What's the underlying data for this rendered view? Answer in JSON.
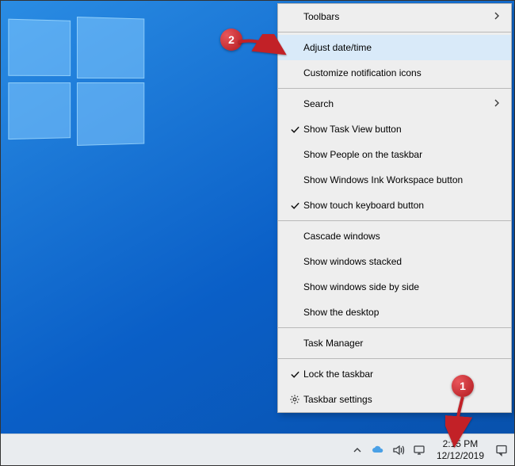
{
  "menu": {
    "items": [
      {
        "label": "Toolbars",
        "checked": false,
        "submenu": true,
        "icon": null
      },
      {
        "label": "Adjust date/time",
        "checked": false,
        "submenu": false,
        "icon": null
      },
      {
        "label": "Customize notification icons",
        "checked": false,
        "submenu": false,
        "icon": null
      },
      {
        "label": "Search",
        "checked": false,
        "submenu": true,
        "icon": null
      },
      {
        "label": "Show Task View button",
        "checked": true,
        "submenu": false,
        "icon": null
      },
      {
        "label": "Show People on the taskbar",
        "checked": false,
        "submenu": false,
        "icon": null
      },
      {
        "label": "Show Windows Ink Workspace button",
        "checked": false,
        "submenu": false,
        "icon": null
      },
      {
        "label": "Show touch keyboard button",
        "checked": true,
        "submenu": false,
        "icon": null
      },
      {
        "label": "Cascade windows",
        "checked": false,
        "submenu": false,
        "icon": null
      },
      {
        "label": "Show windows stacked",
        "checked": false,
        "submenu": false,
        "icon": null
      },
      {
        "label": "Show windows side by side",
        "checked": false,
        "submenu": false,
        "icon": null
      },
      {
        "label": "Show the desktop",
        "checked": false,
        "submenu": false,
        "icon": null
      },
      {
        "label": "Task Manager",
        "checked": false,
        "submenu": false,
        "icon": null
      },
      {
        "label": "Lock the taskbar",
        "checked": true,
        "submenu": false,
        "icon": null
      },
      {
        "label": "Taskbar settings",
        "checked": false,
        "submenu": false,
        "icon": "gear"
      }
    ],
    "groupSeparatorsAfter": [
      0,
      2,
      7,
      11,
      12
    ]
  },
  "taskbar": {
    "time": "2:15 PM",
    "date": "12/12/2019"
  },
  "annotations": {
    "step1": "1",
    "step2": "2"
  },
  "colors": {
    "annotation_red": "#c22127"
  }
}
